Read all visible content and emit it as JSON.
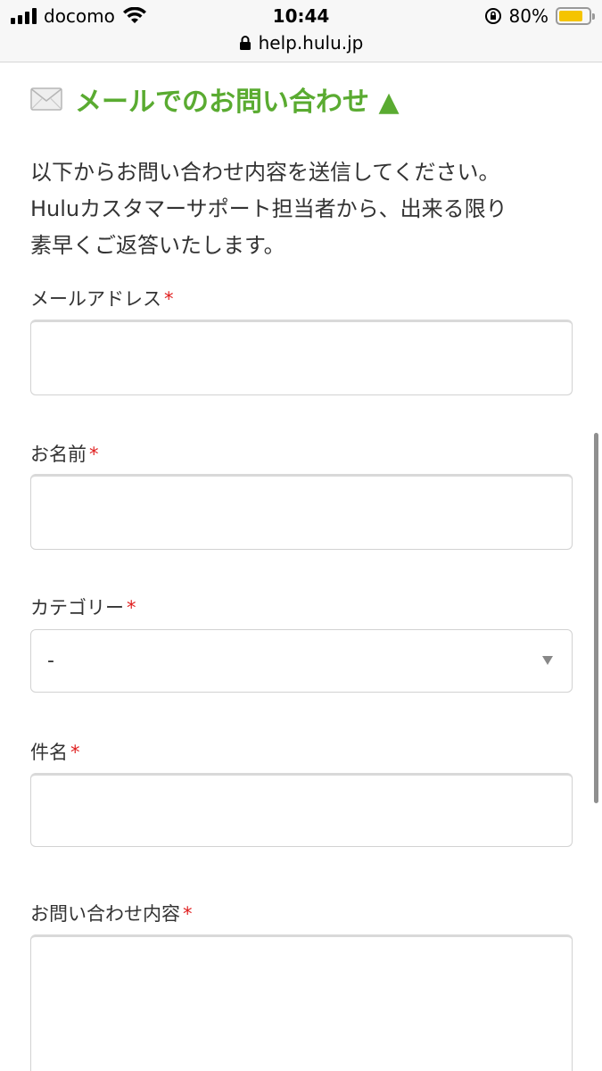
{
  "status_bar": {
    "carrier": "docomo",
    "time": "10:44",
    "battery_percent": "80%",
    "battery_level": 0.8,
    "url": "help.hulu.jp",
    "icons": [
      "signal-icon",
      "wifi-icon",
      "rotation-lock-icon",
      "battery-icon",
      "lock-icon"
    ]
  },
  "section": {
    "title": "メールでのお問い合わせ ▲",
    "title_color": "#5aab31",
    "icon": "mail-icon",
    "intro_lines": [
      "以下からお問い合わせ内容を送信してください。",
      "Huluカスタマーサポート担当者から、出来る限り",
      "素早くご返答いたします。"
    ]
  },
  "form": {
    "required_mark": "*",
    "required_color": "#e02020",
    "email_label": "メールアドレス",
    "email_value": "",
    "name_label": "お名前",
    "name_value": "",
    "category_label": "カテゴリー",
    "category_selected": "-",
    "subject_label": "件名",
    "subject_value": "",
    "message_label": "お問い合わせ内容",
    "message_value": ""
  }
}
